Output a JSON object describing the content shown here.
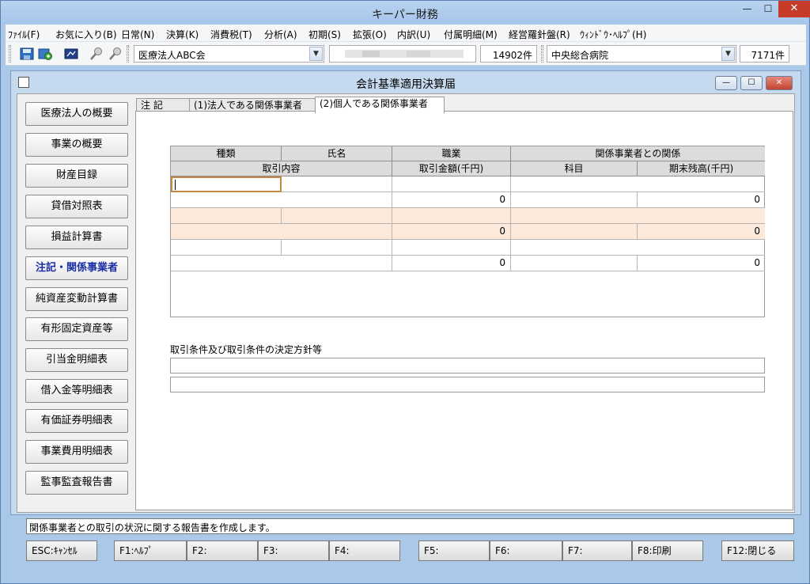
{
  "window": {
    "title": "キーパー財務",
    "minimize": "—",
    "maximize": "☐",
    "close": "✕"
  },
  "menu": [
    "ﾌｧｲﾙ(F)",
    "お気に入り(B)",
    "日常(N)",
    "決算(K)",
    "消費税(T)",
    "分析(A)",
    "初期(S)",
    "拡張(O)",
    "内訳(U)",
    "付属明細(M)",
    "経営羅針盤(R)",
    "ｳｨﾝﾄﾞｳ･ﾍﾙﾌﾟ(H)"
  ],
  "toolbar": {
    "corp_combo": "医療法人ABC会",
    "count1": "14902件",
    "hospital_combo": "中央総合病院",
    "count2": "7171件"
  },
  "child": {
    "title": "会計基準適用決算届",
    "min": "—",
    "max": "☐",
    "close": "✕"
  },
  "nav": [
    "医療法人の概要",
    "事業の概要",
    "財産目録",
    "貸借対照表",
    "損益計算書",
    "注記・関係事業者",
    "純資産変動計算書",
    "有形固定資産等",
    "引当金明細表",
    "借入金等明細表",
    "有価証券明細表",
    "事業費用明細表",
    "監事監査報告書"
  ],
  "tabs": [
    "注 記",
    "(1)法人である関係事業者",
    "(2)個人である関係事業者"
  ],
  "grid": {
    "h1": [
      "種類",
      "氏名",
      "職業",
      "関係事業者との関係"
    ],
    "h2": [
      "取引内容",
      "取引金額(千円)",
      "科目",
      "期末残高(千円)"
    ],
    "rows": [
      {
        "amount": "0",
        "balance": "0"
      },
      {
        "amount": "0",
        "balance": "0"
      },
      {
        "amount": "0",
        "balance": "0"
      }
    ]
  },
  "conditions": {
    "label": "取引条件及び取引条件の決定方針等"
  },
  "status": "関係事業者との取引の状況に関する報告書を作成します。",
  "fkeys": [
    "ESC:ｷｬﾝｾﾙ",
    "F1:ﾍﾙﾌﾟ",
    "F2:",
    "F3:",
    "F4:",
    "F5:",
    "F6:",
    "F7:",
    "F8:印刷",
    "F12:閉じる"
  ]
}
